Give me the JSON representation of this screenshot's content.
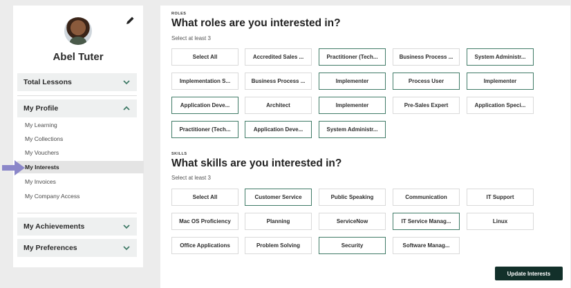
{
  "profile": {
    "name": "Abel Tuter"
  },
  "sidebar": {
    "sections": [
      {
        "label": "Total Lessons",
        "expanded": false
      },
      {
        "label": "My Profile",
        "expanded": true
      },
      {
        "label": "My Achievements",
        "expanded": false
      },
      {
        "label": "My Preferences",
        "expanded": false
      }
    ],
    "profile_items": [
      "My Learning",
      "My Collections",
      "My Vouchers",
      "My Interests",
      "My Invoices",
      "My Company Access"
    ],
    "active_item": "My Interests"
  },
  "roles": {
    "label": "ROLES",
    "title": "What roles are you interested in?",
    "subtitle": "Select at least 3",
    "chips": [
      {
        "label": "Select All",
        "selected": false
      },
      {
        "label": "Accredited Sales ...",
        "selected": false
      },
      {
        "label": "Practitioner (Tech...",
        "selected": true
      },
      {
        "label": "Business Process ...",
        "selected": false
      },
      {
        "label": "System Administr...",
        "selected": true
      },
      {
        "label": "Implementation S...",
        "selected": false
      },
      {
        "label": "Business Process ...",
        "selected": false
      },
      {
        "label": "Implementer",
        "selected": true
      },
      {
        "label": "Process User",
        "selected": true
      },
      {
        "label": "Implementer",
        "selected": true
      },
      {
        "label": "Application Deve...",
        "selected": true
      },
      {
        "label": "Architect",
        "selected": false
      },
      {
        "label": "Implementer",
        "selected": true
      },
      {
        "label": "Pre-Sales Expert",
        "selected": false
      },
      {
        "label": "Application Speci...",
        "selected": false
      },
      {
        "label": "Practitioner (Tech...",
        "selected": true
      },
      {
        "label": "Application Deve...",
        "selected": true
      },
      {
        "label": "System Administr...",
        "selected": true
      }
    ]
  },
  "skills": {
    "label": "SKILLS",
    "title": "What skills are you interested in?",
    "subtitle": "Select at least 3",
    "chips": [
      {
        "label": "Select All",
        "selected": false
      },
      {
        "label": "Customer Service",
        "selected": true
      },
      {
        "label": "Public Speaking",
        "selected": false
      },
      {
        "label": "Communication",
        "selected": false
      },
      {
        "label": "IT Support",
        "selected": false
      },
      {
        "label": "Mac OS Proficiency",
        "selected": false
      },
      {
        "label": "Planning",
        "selected": false
      },
      {
        "label": "ServiceNow",
        "selected": false
      },
      {
        "label": "IT Service Manag...",
        "selected": true
      },
      {
        "label": "Linux",
        "selected": false
      },
      {
        "label": "Office Applications",
        "selected": false
      },
      {
        "label": "Problem Solving",
        "selected": false
      },
      {
        "label": "Security",
        "selected": true
      },
      {
        "label": "Software Manag...",
        "selected": false
      }
    ]
  },
  "actions": {
    "update_label": "Update Interests"
  },
  "colors": {
    "selected_border": "#3f7a66",
    "button_bg": "#12302a",
    "pointer": "#8b87c9"
  },
  "icons": {
    "edit": "pencil-icon",
    "expand": "chevron-down-icon",
    "collapse": "chevron-up-icon"
  }
}
